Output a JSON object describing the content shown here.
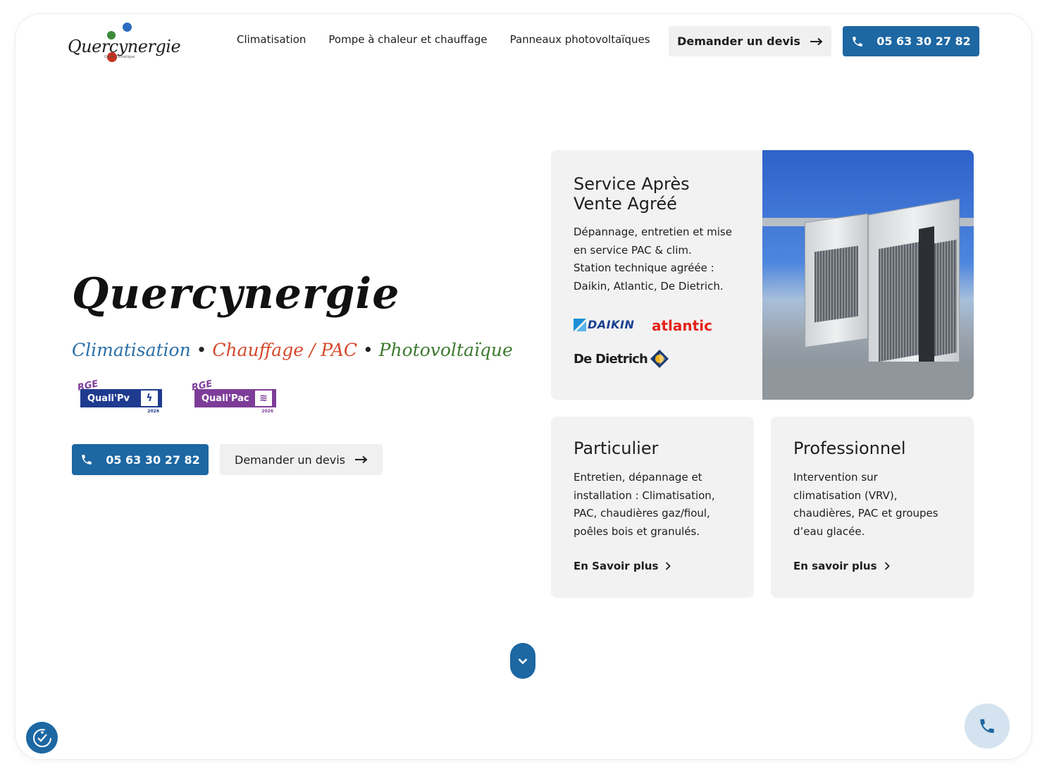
{
  "header": {
    "logo_text": "Quercynergie",
    "logo_subtitle": "Génie Climatique",
    "nav": [
      {
        "label": "Climatisation"
      },
      {
        "label": "Pompe à chaleur et chauffage"
      },
      {
        "label": "Panneaux photovoltaïques"
      }
    ],
    "quote_button": "Demander un devis",
    "phone_button": "05 63 30 27 82"
  },
  "hero": {
    "title": "Quercynergie",
    "tagline": {
      "part1": "Climatisation",
      "sep1": " • ",
      "part2": "Chauffage / PAC",
      "sep2": " • ",
      "part3": "Photovoltaïque"
    },
    "badges": [
      {
        "rge": "RGE",
        "name": "Quali'Pv",
        "year": "2026",
        "color": "#1f3b8f",
        "rge_color": "#7d3c98"
      },
      {
        "rge": "RGE",
        "name": "Quali'Pac",
        "year": "2026",
        "color": "#7d3c98",
        "rge_color": "#7d3c98"
      }
    ],
    "phone_button": "05 63 30 27 82",
    "quote_button": "Demander un devis"
  },
  "sav_card": {
    "title_line1": "Service Après",
    "title_line2": "Vente Agréé",
    "text_line1": "Dépannage, entretien et mise",
    "text_line2": "en service PAC & clim.",
    "text_line3": "Station technique agréée :",
    "text_line4": "Daikin, Atlantic, De Dietrich.",
    "brands": {
      "daikin": "DAIKIN",
      "atlantic": "atlantic",
      "dedietrich": "De Dietrich"
    }
  },
  "particulier_card": {
    "title": "Particulier",
    "lines": [
      "Entretien, dépannage et",
      "installation : Climatisation,",
      "PAC, chaudières gaz/fioul,",
      "poêles bois et granulés."
    ],
    "link": "En Savoir plus"
  },
  "professionnel_card": {
    "title": "Professionnel",
    "lines": [
      "Intervention sur",
      "climatisation (VRV),",
      "chaudières, PAC et groupes",
      "d’eau glacée."
    ],
    "link": "En savoir plus"
  },
  "colors": {
    "brand_blue": "#1d67a3",
    "card_bg": "#f2f2f2",
    "tag_blue": "#2a6fa8",
    "tag_red": "#d4482b",
    "tag_green": "#3e7a30",
    "daikin_blue": "#1a8fd6",
    "atlantic_red": "#e2231a"
  },
  "icons": [
    "phone-icon",
    "arrow-right-icon",
    "chevron-right-icon",
    "chevron-down-icon",
    "accessibility-icon"
  ]
}
